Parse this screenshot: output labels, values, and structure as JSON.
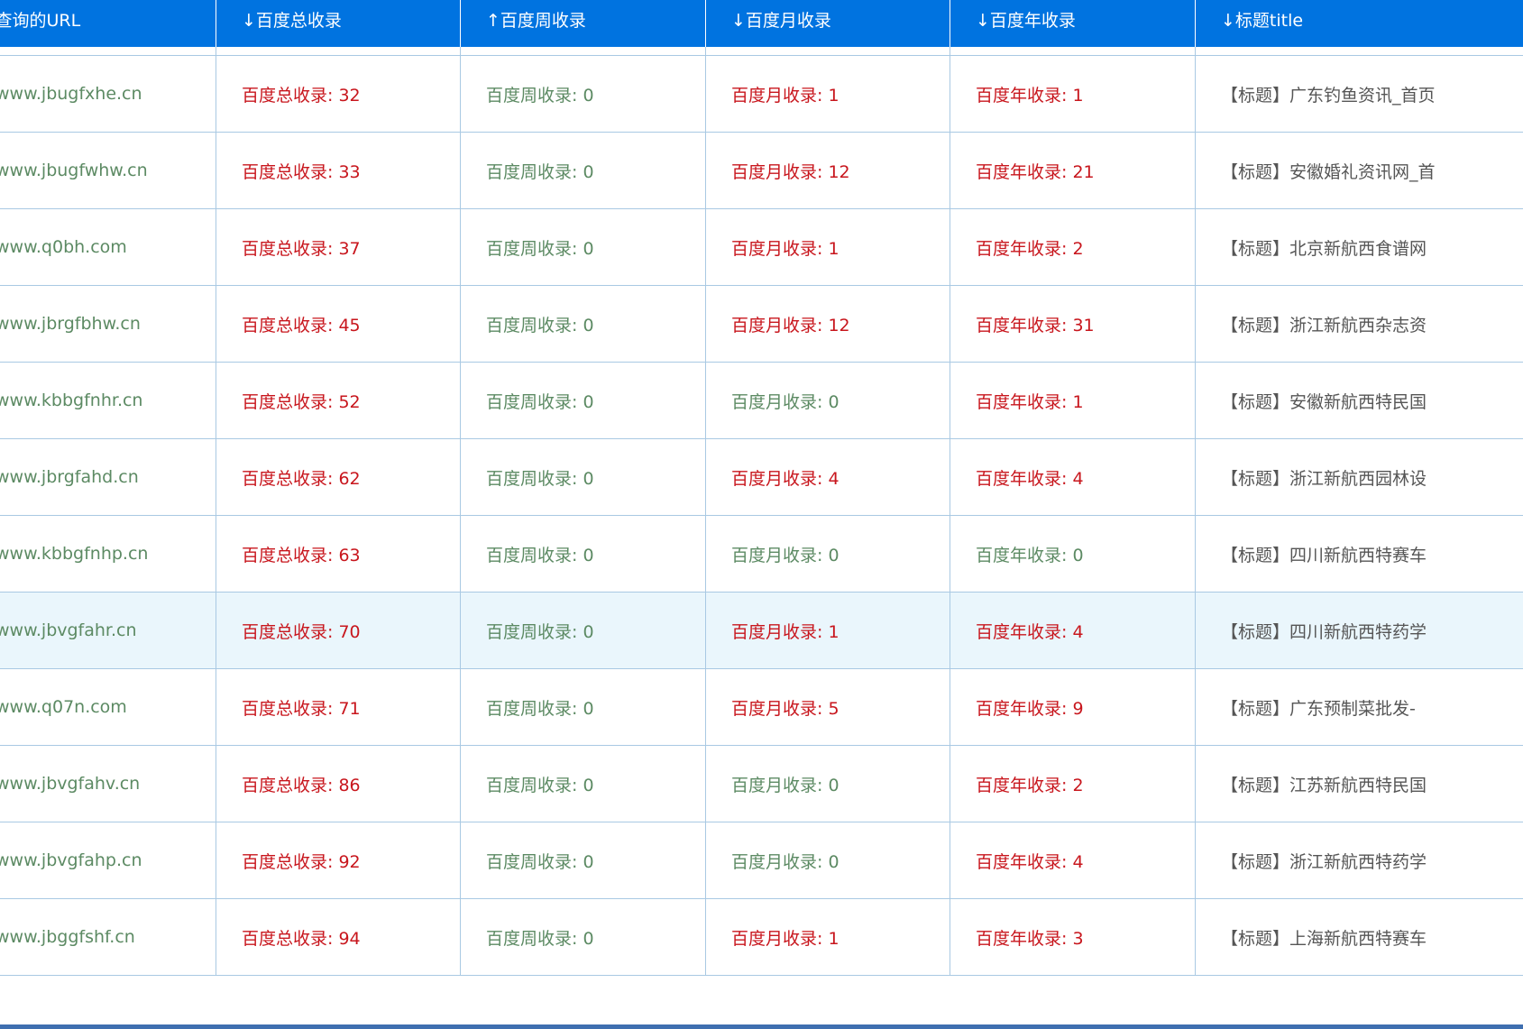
{
  "header": {
    "url": "查询的URL",
    "total": "↓百度总收录",
    "week": "↑百度周收录",
    "month": "↓百度月收录",
    "year": "↓百度年收录",
    "title": "↓标题title"
  },
  "colors": {
    "header_bg": "#0073e0",
    "green": "#5c8a63",
    "red": "#c8161d",
    "highlight_bg": "#eaf6fc",
    "border": "#a9c9e3"
  },
  "rows": [
    {
      "url": "www.jbugfxhe.cn",
      "total": "百度总收录: 32",
      "week": "百度周收录: 0",
      "month": "百度月收录: 1",
      "year": "百度年收录: 1",
      "title": "【标题】广东钓鱼资讯_首页"
    },
    {
      "url": "www.jbugfwhw.cn",
      "total": "百度总收录: 33",
      "week": "百度周收录: 0",
      "month": "百度月收录: 12",
      "year": "百度年收录: 21",
      "title": "【标题】安徽婚礼资讯网_首"
    },
    {
      "url": "www.q0bh.com",
      "total": "百度总收录: 37",
      "week": "百度周收录: 0",
      "month": "百度月收录: 1",
      "year": "百度年收录: 2",
      "title": "【标题】北京新航西食谱网"
    },
    {
      "url": "www.jbrgfbhw.cn",
      "total": "百度总收录: 45",
      "week": "百度周收录: 0",
      "month": "百度月收录: 12",
      "year": "百度年收录: 31",
      "title": "【标题】浙江新航西杂志资"
    },
    {
      "url": "www.kbbgfnhr.cn",
      "total": "百度总收录: 52",
      "week": "百度周收录: 0",
      "month": "百度月收录: 0",
      "year": "百度年收录: 1",
      "title": "【标题】安徽新航西特民国"
    },
    {
      "url": "www.jbrgfahd.cn",
      "total": "百度总收录: 62",
      "week": "百度周收录: 0",
      "month": "百度月收录: 4",
      "year": "百度年收录: 4",
      "title": "【标题】浙江新航西园林设"
    },
    {
      "url": "www.kbbgfnhp.cn",
      "total": "百度总收录: 63",
      "week": "百度周收录: 0",
      "month": "百度月收录: 0",
      "year": "百度年收录: 0",
      "title": "【标题】四川新航西特赛车"
    },
    {
      "url": "www.jbvgfahr.cn",
      "total": "百度总收录: 70",
      "week": "百度周收录: 0",
      "month": "百度月收录: 1",
      "year": "百度年收录: 4",
      "title": "【标题】四川新航西特药学"
    },
    {
      "url": "www.q07n.com",
      "total": "百度总收录: 71",
      "week": "百度周收录: 0",
      "month": "百度月收录: 5",
      "year": "百度年收录: 9",
      "title": "【标题】广东预制菜批发-"
    },
    {
      "url": "www.jbvgfahv.cn",
      "total": "百度总收录: 86",
      "week": "百度周收录: 0",
      "month": "百度月收录: 0",
      "year": "百度年收录: 2",
      "title": "【标题】江苏新航西特民国"
    },
    {
      "url": "www.jbvgfahp.cn",
      "total": "百度总收录: 92",
      "week": "百度周收录: 0",
      "month": "百度月收录: 0",
      "year": "百度年收录: 4",
      "title": "【标题】浙江新航西特药学"
    },
    {
      "url": "www.jbggfshf.cn",
      "total": "百度总收录: 94",
      "week": "百度周收录: 0",
      "month": "百度月收录: 1",
      "year": "百度年收录: 3",
      "title": "【标题】上海新航西特赛车"
    }
  ]
}
